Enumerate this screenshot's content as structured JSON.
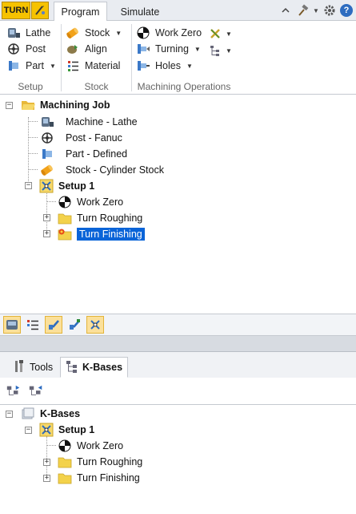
{
  "ribbon_tabs": {
    "app_label": "TURN",
    "program": "Program",
    "simulate": "Simulate"
  },
  "ribbon": {
    "setup": {
      "title": "Setup",
      "lathe": "Lathe",
      "post": "Post",
      "part": "Part"
    },
    "stock": {
      "title": "Stock",
      "stock": "Stock",
      "align": "Align",
      "material": "Material"
    },
    "machining": {
      "title": "Machining Operations",
      "work_zero": "Work Zero",
      "turning": "Turning",
      "holes": "Holes"
    }
  },
  "job_tree": {
    "root": "Machining Job",
    "machine": "Machine - Lathe",
    "post": "Post - Fanuc",
    "part": "Part - Defined",
    "stock": "Stock - Cylinder Stock",
    "setup": "Setup 1",
    "work_zero": "Work Zero",
    "roughing": "Turn Roughing",
    "finishing": "Turn Finishing"
  },
  "bottom_tabs": {
    "tools": "Tools",
    "kbases": "K-Bases"
  },
  "kbase_tree": {
    "root": "K-Bases",
    "setup": "Setup 1",
    "work_zero": "Work Zero",
    "roughing": "Turn Roughing",
    "finishing": "Turn Finishing"
  },
  "colors": {
    "accent_yellow": "#f6c200",
    "selection_blue": "#0a64d8",
    "folder_yellow": "#f3d24b"
  }
}
